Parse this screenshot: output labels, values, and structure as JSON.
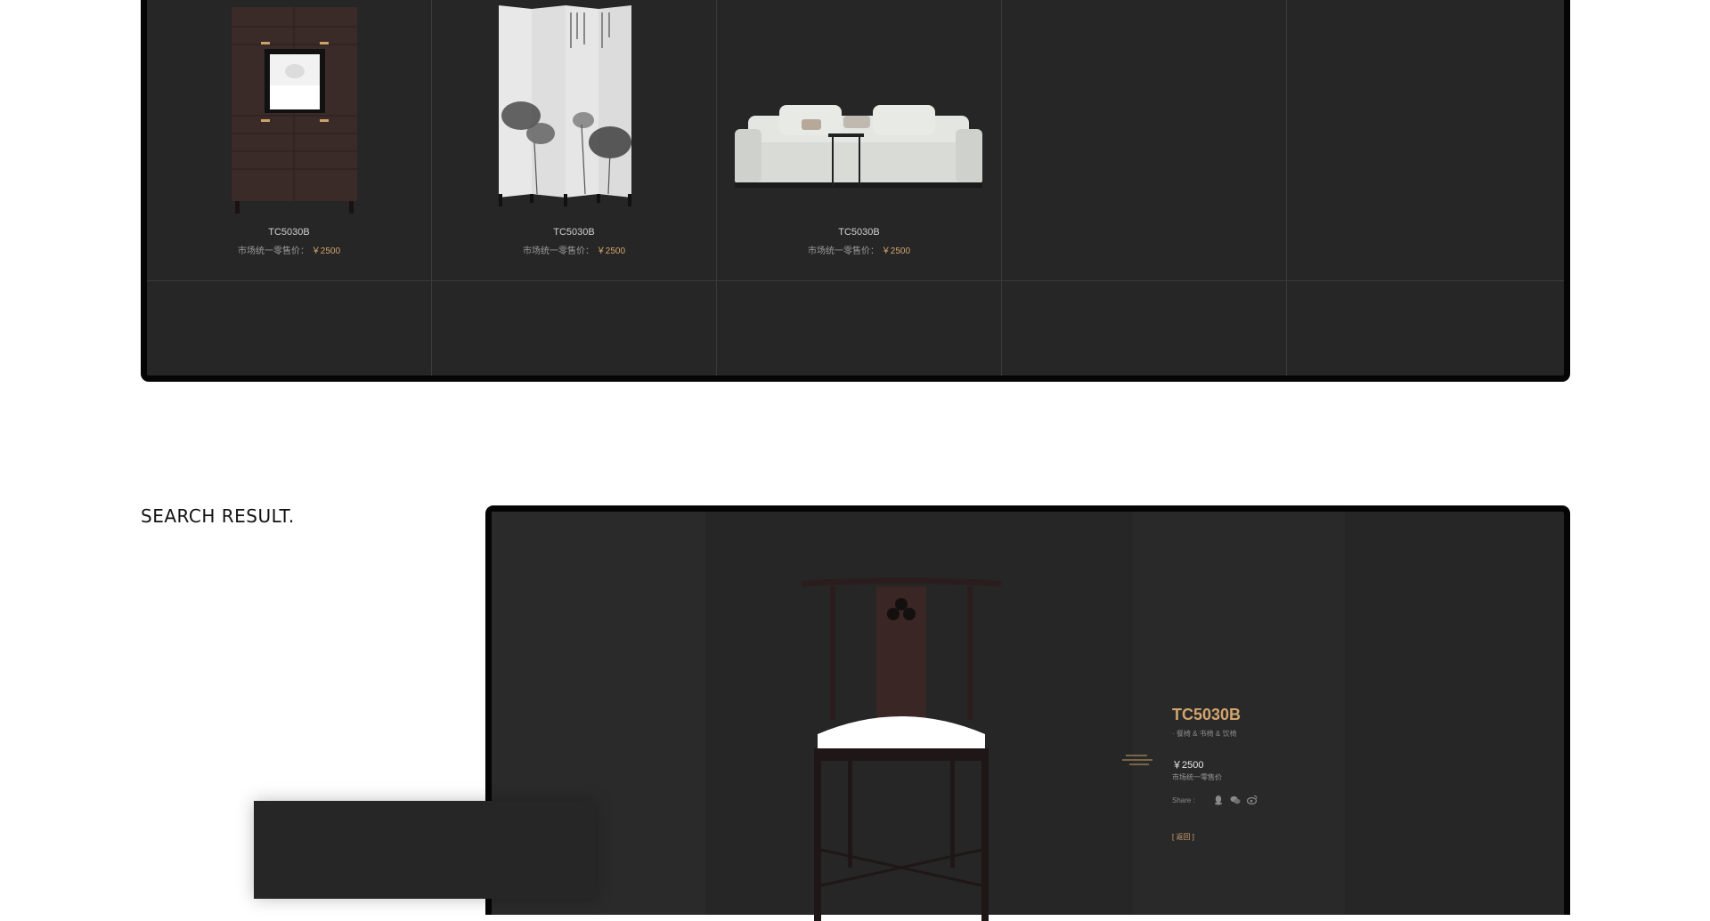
{
  "top_grid": {
    "products": [
      {
        "model": "TC5030B",
        "price_label": "市场统一零售价：",
        "price": "￥2500",
        "image": "cabinet-image"
      },
      {
        "model": "TC5030B",
        "price_label": "市场统一零售价：",
        "price": "￥2500",
        "image": "folding-screen-image"
      },
      {
        "model": "TC5030B",
        "price_label": "市场统一零售价：",
        "price": "￥2500",
        "image": "sofa-image"
      }
    ]
  },
  "search": {
    "heading": "SEARCH RESULT."
  },
  "detail": {
    "title": "TC5030B",
    "subtitle": "· 餐椅 & 书椅 & 饮椅",
    "price": "￥2500",
    "price_label": "市场统一零售价",
    "share_label": "Share :",
    "share_icons": [
      "qq-icon",
      "wechat-icon",
      "weibo-icon"
    ],
    "back_label": "[ 返回 ]",
    "image": "chair-image"
  },
  "colors": {
    "panel_bg": "#262626",
    "frame_border": "#050505",
    "accent_gold": "#d2a46e"
  }
}
